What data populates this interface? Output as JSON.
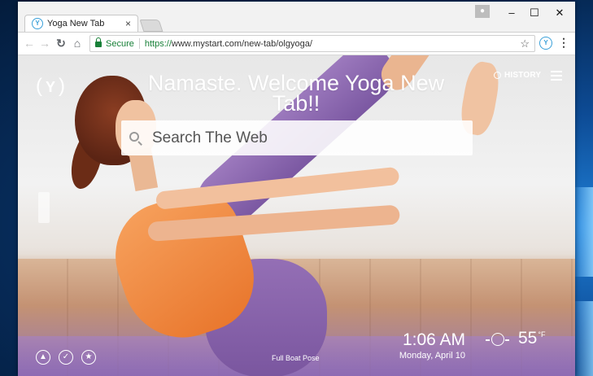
{
  "browser": {
    "tab_title": "Yoga New Tab",
    "tab_favicon": "Y",
    "tab_close": "×",
    "security_label": "Secure",
    "url_scheme": "https://",
    "url_rest": "www.mystart.com/new-tab/olgyoga/",
    "window_minimize": "–",
    "window_maximize": "☐",
    "window_close": "✕",
    "extension_icon": "Y"
  },
  "page": {
    "logo": "Y",
    "headline": "Namaste. Welcome Yoga New Tab!!",
    "history_label": "HISTORY",
    "search_placeholder": "Search The Web",
    "pose_label": "Full Boat Pose",
    "time": "1:06 AM",
    "date": "Monday, April 10",
    "temperature": "55",
    "temperature_unit": "°F"
  },
  "icons": {
    "back": "back-arrow-icon",
    "forward": "forward-arrow-icon",
    "reload": "reload-icon",
    "home": "home-icon",
    "bookmark": "star-icon",
    "menu": "kebab-menu-icon",
    "history": "history-clock-icon",
    "hamburger": "hamburger-menu-icon",
    "bottom": [
      "image-icon",
      "check-circle-icon",
      "star-circle-icon"
    ],
    "weather": "sun-icon"
  },
  "colors": {
    "secure_green": "#188038",
    "accent_blue": "#3aa0d9"
  }
}
